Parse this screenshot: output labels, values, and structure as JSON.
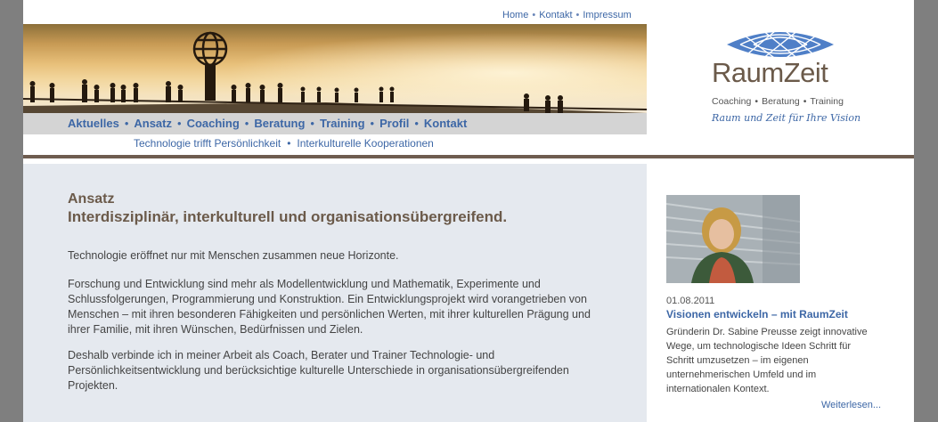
{
  "top_links": [
    "Home",
    "Kontakt",
    "Impressum"
  ],
  "main_nav": [
    "Aktuelles",
    "Ansatz",
    "Coaching",
    "Beratung",
    "Training",
    "Profil",
    "Kontakt"
  ],
  "sub_nav": [
    "Technologie trifft Persönlichkeit",
    "Interkulturelle Kooperationen"
  ],
  "logo": {
    "name": "RaumZeit",
    "tagline": [
      "Coaching",
      "Beratung",
      "Training"
    ],
    "slogan": "Raum und Zeit für Ihre Vision"
  },
  "content": {
    "title": "Ansatz",
    "subtitle": "Interdisziplinär, interkulturell und organisationsübergreifend.",
    "paragraphs": [
      "Technologie eröffnet nur mit Menschen zusammen neue Horizonte.",
      "Forschung und Entwicklung sind mehr als Modellentwicklung und Mathematik, Experimente und Schlussfolgerungen, Programmierung und Konstruktion. Ein Entwicklungsprojekt wird vorangetrieben von Menschen – mit ihren besonderen Fähigkeiten und persönlichen Werten, mit ihrer kulturellen Prägung und ihrer Familie, mit ihren Wünschen, Bedürfnissen und Zielen.",
      "Deshalb verbinde ich in meiner Arbeit als Coach, Berater und Trainer Technologie- und Persönlichkeitsentwicklung und berücksichtige kulturelle Unterschiede in organisationsübergreifenden Projekten."
    ]
  },
  "news": {
    "date": "01.08.2011",
    "title": "Visionen entwickeln – mit RaumZeit",
    "text": "Gründerin Dr. Sabine Preusse zeigt innovative Wege, um technologische Ideen Schritt für Schritt umzusetzen – im eigenen unternehmerischen Umfeld und im internationalen Kontext.",
    "more": "Weiterlesen..."
  },
  "colors": {
    "link": "#3d67a6",
    "heading": "#6b5a4a",
    "frame": "#7f7f7f",
    "content_bg": "#e5e9ef"
  }
}
